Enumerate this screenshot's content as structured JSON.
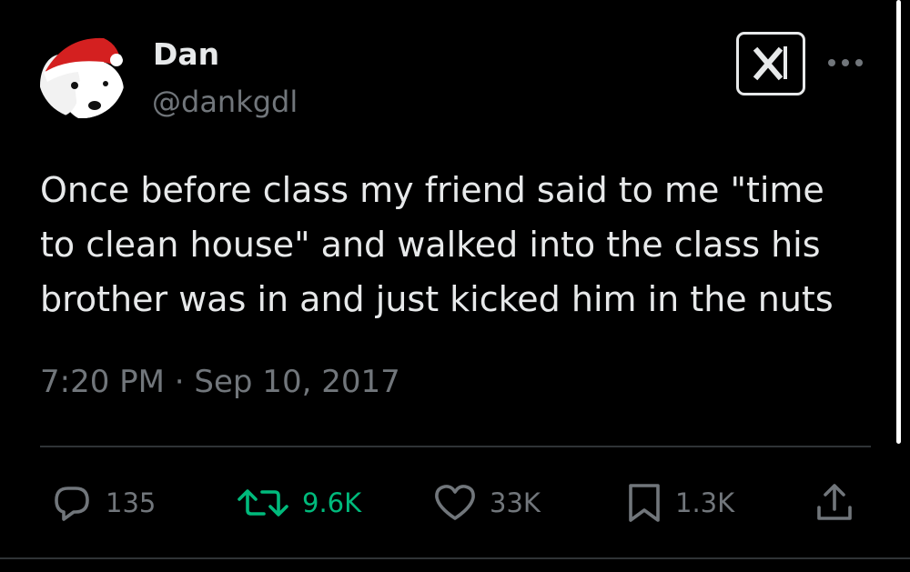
{
  "user": {
    "display_name": "Dan",
    "handle": "@dankgdl",
    "avatar_icon": "horse-santa-hat-avatar"
  },
  "badge_icon": "grok-x-icon",
  "tweet": {
    "text": "Once before class my friend said to me \"time\nto clean house\" and walked into the class his\nbrother was in and just kicked him in the nuts",
    "timestamp": "7:20 PM · Sep 10, 2017"
  },
  "actions": {
    "replies": "135",
    "retweets": "9.6K",
    "likes": "33K",
    "bookmarks": "1.3K"
  },
  "colors": {
    "background": "#000000",
    "text_primary": "#e7e9ea",
    "text_secondary": "#71767b",
    "retweet_green": "#00ba7c",
    "divider": "#2f3336"
  }
}
